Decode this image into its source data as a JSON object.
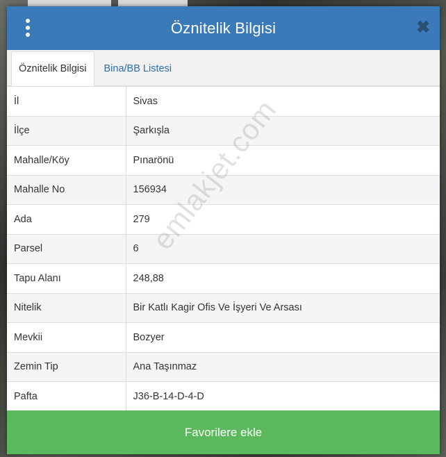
{
  "dialog": {
    "title": "Öznitelik Bilgisi",
    "close_symbol": "✖"
  },
  "tabs": [
    {
      "label": "Öznitelik Bilgisi",
      "active": true
    },
    {
      "label": "Bina/BB Listesi",
      "active": false
    }
  ],
  "attributes": [
    {
      "key": "İl",
      "value": "Sivas"
    },
    {
      "key": "İlçe",
      "value": "Şarkışla"
    },
    {
      "key": "Mahalle/Köy",
      "value": "Pınarönü"
    },
    {
      "key": "Mahalle No",
      "value": "156934"
    },
    {
      "key": "Ada",
      "value": "279"
    },
    {
      "key": "Parsel",
      "value": "6"
    },
    {
      "key": "Tapu Alanı",
      "value": "248,88"
    },
    {
      "key": "Nitelik",
      "value": "Bir Katlı Kagir Ofis Ve İşyeri Ve Arsası"
    },
    {
      "key": "Mevkii",
      "value": "Bozyer"
    },
    {
      "key": "Zemin Tip",
      "value": "Ana Taşınmaz"
    },
    {
      "key": "Pafta",
      "value": "J36-B-14-D-4-D"
    }
  ],
  "watermark": "emlakjet.com",
  "footer": {
    "favorite_label": "Favorilere ekle"
  },
  "colors": {
    "header": "#3a7ab8",
    "favorite_button": "#5cb85c",
    "tab_link": "#2f6fa8"
  },
  "icons": {
    "menu": "vertical-ellipsis-icon",
    "close": "close-icon"
  }
}
